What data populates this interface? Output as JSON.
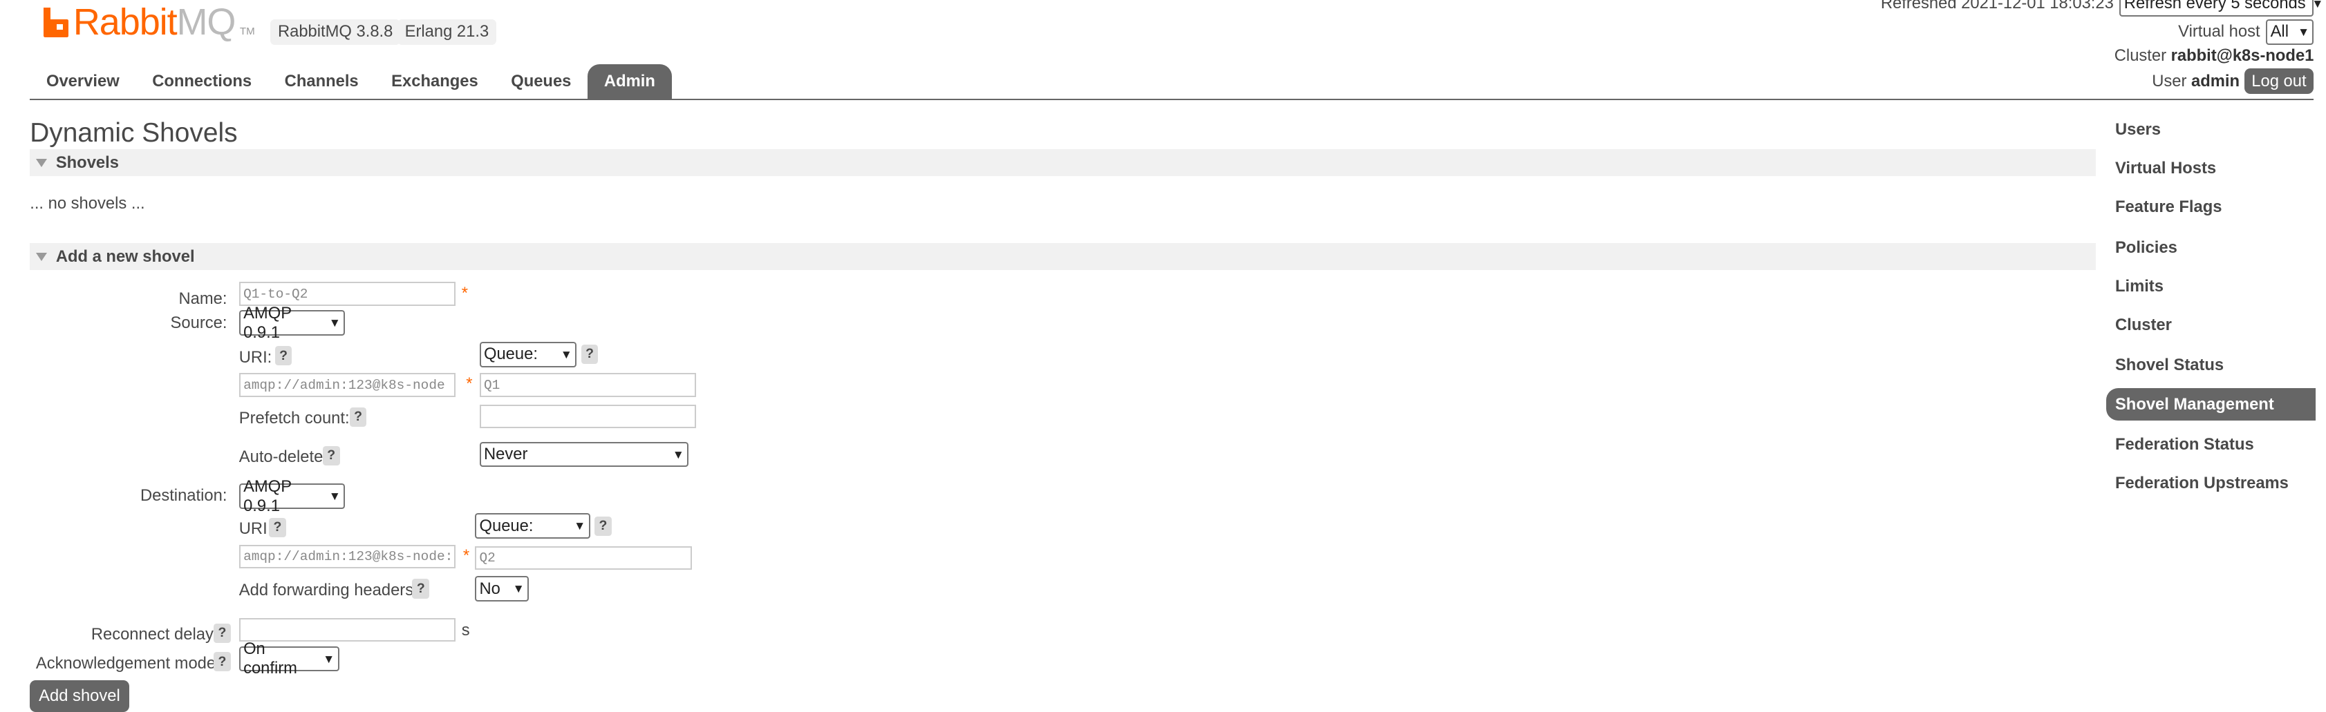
{
  "header": {
    "logo_rabbit": "Rabbit",
    "logo_mq": "MQ",
    "logo_tm": "TM",
    "rabbitmq_version": "RabbitMQ 3.8.8",
    "erlang_version": "Erlang 21.3",
    "refreshed_label": "Refreshed 2021-12-01 18:03:23",
    "refresh_select": "Refresh every 5 seconds",
    "virtual_host_label": "Virtual host",
    "virtual_host_value": "All",
    "cluster_label": "Cluster",
    "cluster_value": "rabbit@k8s-node1",
    "user_label": "User",
    "user_value": "admin",
    "logout_label": "Log out"
  },
  "tabs": [
    {
      "label": "Overview",
      "active": false
    },
    {
      "label": "Connections",
      "active": false
    },
    {
      "label": "Channels",
      "active": false
    },
    {
      "label": "Exchanges",
      "active": false
    },
    {
      "label": "Queues",
      "active": false
    },
    {
      "label": "Admin",
      "active": true
    }
  ],
  "page_title": "Dynamic Shovels",
  "shovels_section": {
    "title": "Shovels",
    "empty_text": "... no shovels ..."
  },
  "add_section": {
    "title": "Add a new shovel",
    "name_label": "Name:",
    "name_value": "Q1-to-Q2",
    "source_label": "Source:",
    "source_protocol": "AMQP 0.9.1",
    "source_uri_label": "URI:",
    "source_uri_value": "amqp://admin:123@k8s-node",
    "source_type": "Queue:",
    "source_queue_value": "Q1",
    "prefetch_label": "Prefetch count:",
    "prefetch_value": "",
    "auto_delete_label": "Auto-delete",
    "auto_delete_value": "Never",
    "destination_label": "Destination:",
    "dest_protocol": "AMQP 0.9.1",
    "dest_uri_label": "URI",
    "dest_uri_value": "amqp://admin:123@k8s-node:",
    "dest_type": "Queue:",
    "dest_queue_value": "Q2",
    "fwd_headers_label": "Add forwarding headers:",
    "fwd_headers_value": "No",
    "reconnect_label": "Reconnect delay:",
    "reconnect_value": "",
    "reconnect_unit": "s",
    "ack_label": "Acknowledgement mode:",
    "ack_value": "On confirm",
    "help": "?",
    "required": "*",
    "submit_label": "Add shovel"
  },
  "sidebar": [
    {
      "label": "Users",
      "active": false
    },
    {
      "label": "Virtual Hosts",
      "active": false
    },
    {
      "label": "Feature Flags",
      "active": false
    },
    {
      "label": "Policies",
      "active": false
    },
    {
      "label": "Limits",
      "active": false
    },
    {
      "label": "Cluster",
      "active": false
    },
    {
      "label": "Shovel Status",
      "active": false
    },
    {
      "label": "Shovel Management",
      "active": true
    },
    {
      "label": "Federation Status",
      "active": false
    },
    {
      "label": "Federation Upstreams",
      "active": false
    }
  ],
  "colors": {
    "brand": "#ff6600",
    "active_tab": "#666666"
  }
}
